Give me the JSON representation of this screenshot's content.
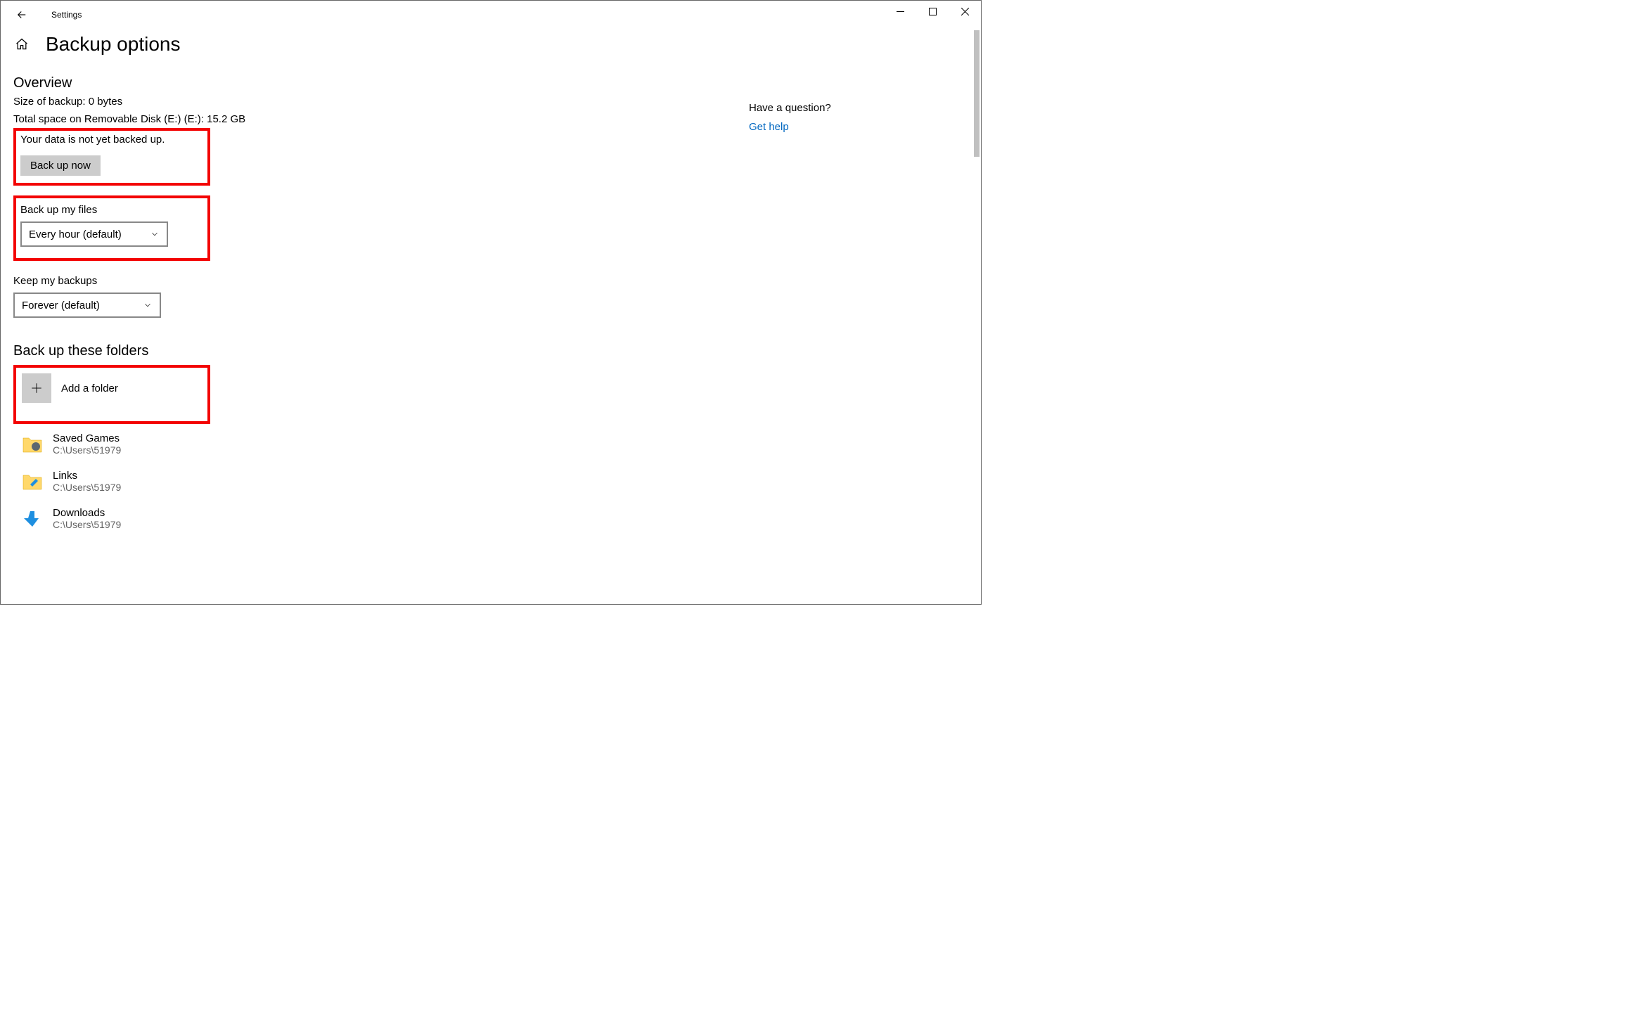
{
  "window": {
    "title": "Settings"
  },
  "page": {
    "title": "Backup options"
  },
  "overview": {
    "heading": "Overview",
    "size_line": "Size of backup: 0 bytes",
    "space_line": "Total space on Removable Disk (E:) (E:): 15.2 GB",
    "status_line": "Your data is not yet backed up.",
    "backup_now_label": "Back up now"
  },
  "frequency": {
    "label": "Back up my files",
    "selected": "Every hour (default)"
  },
  "retention": {
    "label": "Keep my backups",
    "selected": "Forever (default)"
  },
  "folders": {
    "heading": "Back up these folders",
    "add_label": "Add a folder",
    "items": [
      {
        "name": "Saved Games",
        "path": "C:\\Users\\51979"
      },
      {
        "name": "Links",
        "path": "C:\\Users\\51979"
      },
      {
        "name": "Downloads",
        "path": "C:\\Users\\51979"
      }
    ]
  },
  "help": {
    "heading": "Have a question?",
    "link_label": "Get help"
  }
}
